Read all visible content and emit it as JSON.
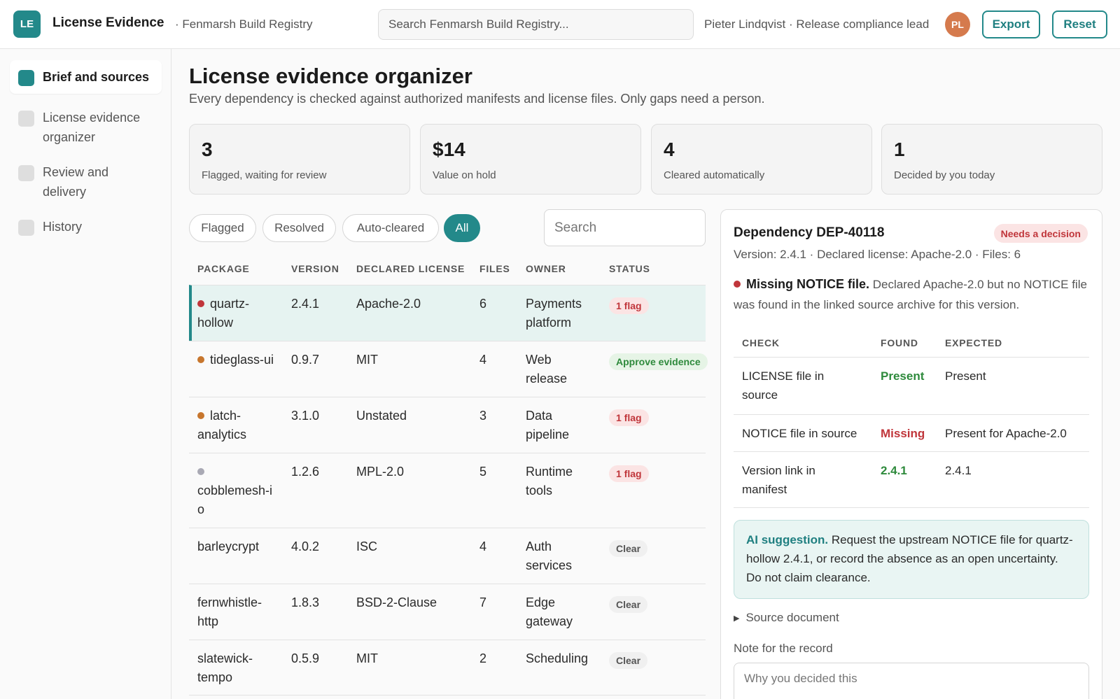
{
  "header": {
    "logo_text": "LE",
    "app_title": "License Evidence",
    "workspace": "· Fenmarsh Build Registry",
    "search_placeholder": "Search Fenmarsh Build Registry...",
    "user_text": "Pieter Lindqvist · Release compliance lead",
    "avatar_initials": "PL",
    "export_label": "Export",
    "reset_label": "Reset"
  },
  "sidebar": {
    "items": [
      {
        "label": "Brief and sources",
        "active": true
      },
      {
        "label": "License evidence organizer",
        "active": false
      },
      {
        "label": "Review and delivery",
        "active": false
      },
      {
        "label": "History",
        "active": false
      }
    ]
  },
  "main": {
    "title": "License evidence organizer",
    "subtitle": "Every dependency is checked against authorized manifests and license files. Only gaps need a person."
  },
  "stats": [
    {
      "value": "3",
      "caption": "Flagged, waiting for review"
    },
    {
      "value": "$14",
      "caption": "Value on hold"
    },
    {
      "value": "4",
      "caption": "Cleared automatically"
    },
    {
      "value": "1",
      "caption": "Decided by you today"
    }
  ],
  "filters": {
    "chips": [
      "Flagged",
      "Resolved",
      "Auto-cleared",
      "All"
    ],
    "active": "All",
    "search_placeholder": "Search"
  },
  "table": {
    "columns": [
      "PACKAGE",
      "VERSION",
      "DECLARED LICENSE",
      "FILES",
      "OWNER",
      "STATUS"
    ],
    "rows": [
      {
        "package": "quartz-hollow",
        "version": "2.4.1",
        "license": "Apache-2.0",
        "files": "6",
        "owner": "Payments platform",
        "status": "1 flag",
        "status_kind": "flag",
        "dot": "red",
        "selected": true
      },
      {
        "package": "tideglass-ui",
        "version": "0.9.7",
        "license": "MIT",
        "files": "4",
        "owner": "Web release",
        "status": "Approve evidence",
        "status_kind": "approve",
        "dot": "orange",
        "selected": false
      },
      {
        "package": "latch-analytics",
        "version": "3.1.0",
        "license": "Unstated",
        "files": "3",
        "owner": "Data pipeline",
        "status": "1 flag",
        "status_kind": "flag",
        "dot": "orange",
        "selected": false
      },
      {
        "package": "cobblemesh-io",
        "version": "1.2.6",
        "license": "MPL-2.0",
        "files": "5",
        "owner": "Runtime tools",
        "status": "1 flag",
        "status_kind": "flag",
        "dot": "grey",
        "selected": false
      },
      {
        "package": "barleycrypt",
        "version": "4.0.2",
        "license": "ISC",
        "files": "4",
        "owner": "Auth services",
        "status": "Clear",
        "status_kind": "clear",
        "dot": "",
        "selected": false
      },
      {
        "package": "fernwhistle-http",
        "version": "1.8.3",
        "license": "BSD-2-Clause",
        "files": "7",
        "owner": "Edge gateway",
        "status": "Clear",
        "status_kind": "clear",
        "dot": "",
        "selected": false
      },
      {
        "package": "slatewick-tempo",
        "version": "0.5.9",
        "license": "MIT",
        "files": "2",
        "owner": "Scheduling",
        "status": "Clear",
        "status_kind": "clear",
        "dot": "",
        "selected": false
      }
    ]
  },
  "detail": {
    "title": "Dependency DEP-40118",
    "badge": "Needs a decision",
    "meta": "Version: 2.4.1 · Declared license: Apache-2.0 · Files: 6",
    "finding_title": "Missing NOTICE file.",
    "finding_text": "Declared Apache-2.0 but no NOTICE file was found in the linked source archive for this version.",
    "check_columns": [
      "CHECK",
      "FOUND",
      "EXPECTED"
    ],
    "checks": [
      {
        "check": "LICENSE file in source",
        "found": "Present",
        "expected": "Present",
        "ok": true
      },
      {
        "check": "NOTICE file in source",
        "found": "Missing",
        "expected": "Present for Apache-2.0",
        "ok": false
      },
      {
        "check": "Version link in manifest",
        "found": "2.4.1",
        "expected": "2.4.1",
        "ok": true
      }
    ],
    "ai_label": "AI suggestion.",
    "ai_text": "Request the upstream NOTICE file for quartz-hollow 2.4.1, or record the absence as an open uncertainty. Do not claim clearance.",
    "source_doc_label": "Source document",
    "note_label": "Note for the record",
    "note_placeholder": "Why you decided this"
  },
  "colors": {
    "accent": "#23898a",
    "flag_red": "#c0363b",
    "approve_green": "#2e8a3c",
    "dot_red": "#c0363b",
    "dot_orange": "#c7762d",
    "dot_grey": "#a9a9b4"
  }
}
